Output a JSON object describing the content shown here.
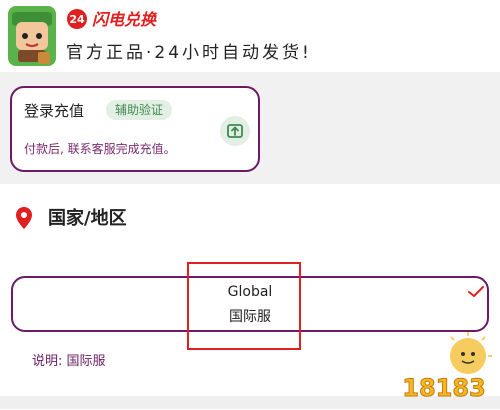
{
  "header": {
    "brand_text": "闪电兑换",
    "brand_badge": "24",
    "slogan": "官方正品·24小时自动发货!"
  },
  "login": {
    "title": "登录充值",
    "badge": "辅助验证",
    "description": "付款后, 联系客服完成充值。",
    "icon": "share-out-icon"
  },
  "country": {
    "title": "国家/地区",
    "icon": "map-pin-icon",
    "selected_en": "Global",
    "selected_zh": "国际服",
    "note": "说明: 国际服"
  },
  "watermark": {
    "text": "18183"
  },
  "colors": {
    "accent_purple": "#6b1a63",
    "badge_green": "#3f8a4f",
    "badge_green_bg": "#e3efe4",
    "pin_red": "#e02020",
    "highlight_red": "#e02020"
  }
}
